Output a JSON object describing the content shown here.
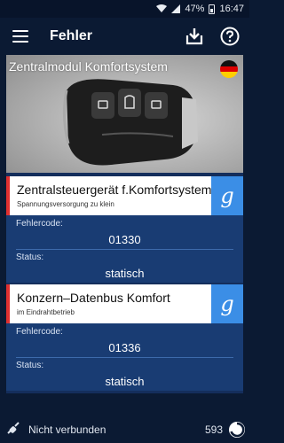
{
  "status_bar": {
    "battery": "47%",
    "time": "16:47"
  },
  "app_bar": {
    "title": "Fehler",
    "icons": [
      "menu-icon",
      "download-icon",
      "help-icon"
    ]
  },
  "module": {
    "title": "Zentralmodul Komfortsystem",
    "flag": "german-flag-icon"
  },
  "faults": [
    {
      "title": "Zentralsteuergerät f.Komfortsystem",
      "subtitle": "Spannungsversorgung zu klein",
      "code_label": "Fehlercode:",
      "code": "01330",
      "status_label": "Status:",
      "status": "statisch"
    },
    {
      "title": "Konzern–Datenbus Komfort",
      "subtitle": "im Eindrahtbetrieb",
      "code_label": "Fehlercode:",
      "code": "01336",
      "status_label": "Status:",
      "status": "statisch"
    }
  ],
  "footer": {
    "connection": "Nicht verbunden",
    "count": "593"
  },
  "colors": {
    "background": "#0b1a33",
    "card": "#193c73",
    "accent_red": "#e03030",
    "google_blue": "#3b8ee6"
  }
}
